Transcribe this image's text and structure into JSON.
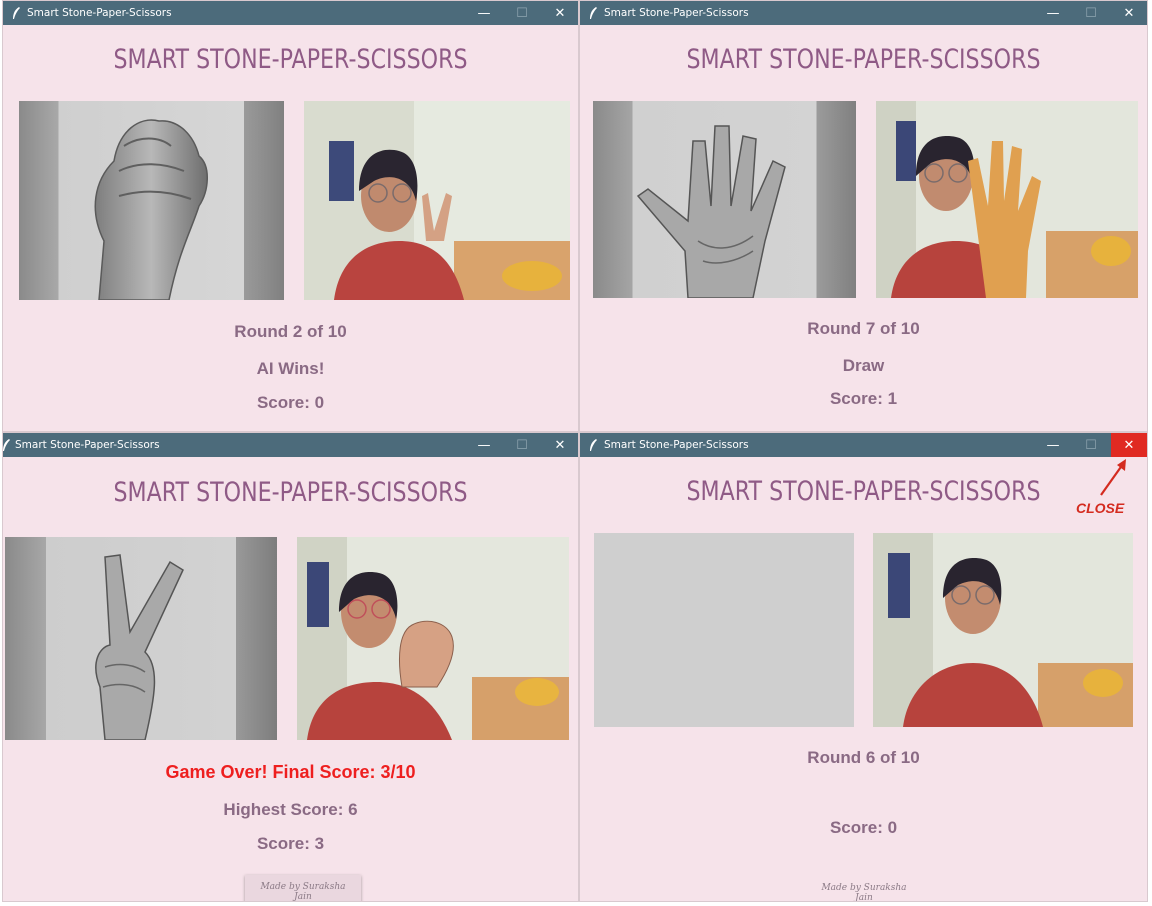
{
  "windows": [
    {
      "window_title": "Smart Stone-Paper-Scissors",
      "app_title": "SMART STONE-PAPER-SCISSORS",
      "ai_gesture": "stone",
      "player_gesture": "scissors",
      "round_text": "Round 2 of 10",
      "result_text": "AI Wins!",
      "score_text": "Score: 0"
    },
    {
      "window_title": "Smart Stone-Paper-Scissors",
      "app_title": "SMART STONE-PAPER-SCISSORS",
      "ai_gesture": "paper",
      "player_gesture": "paper",
      "round_text": "Round 7 of 10",
      "result_text": "Draw",
      "score_text": "Score: 1"
    },
    {
      "window_title": "Smart Stone-Paper-Scissors",
      "app_title": "SMART STONE-PAPER-SCISSORS",
      "ai_gesture": "scissors",
      "player_gesture": "stone",
      "gameover_text": "Game Over! Final Score: 3/10",
      "highest_text": "Highest Score: 6",
      "score_text": "Score: 3",
      "credit_text": "Made by Suraksha Jain"
    },
    {
      "window_title": "Smart Stone-Paper-Scissors",
      "app_title": "SMART STONE-PAPER-SCISSORS",
      "ai_gesture": "none",
      "player_gesture": "none",
      "round_text": "Round 6 of 10",
      "score_text": "Score: 0",
      "credit_text": "Made by Suraksha Jain"
    }
  ],
  "window_controls": {
    "minimize": "—",
    "maximize": "☐",
    "close": "✕"
  },
  "annotation": {
    "label": "CLOSE",
    "color": "#d42b1f"
  },
  "colors": {
    "titlebar": "#4c6b7b",
    "background": "#f6e3ea",
    "title": "#8f5a86",
    "status": "#8a6a84",
    "game_over": "#ee1f1f",
    "close_hover": "#e02a22"
  }
}
